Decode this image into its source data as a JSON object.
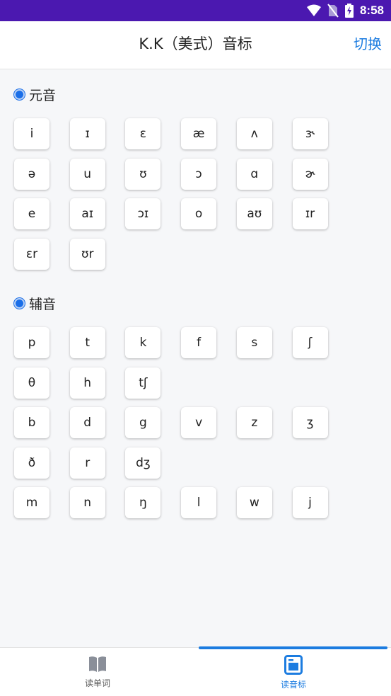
{
  "status_bar": {
    "time": "8:58"
  },
  "app_bar": {
    "title": "K.K（美式）音标",
    "action_label": "切换"
  },
  "vowels": {
    "label": "元音",
    "rows": [
      [
        "i",
        "ɪ",
        "ɛ",
        "æ",
        "ʌ",
        "ɝ"
      ],
      [
        "ə",
        "u",
        "ʊ",
        "ɔ",
        "ɑ",
        "ɚ"
      ],
      [
        "e",
        "aɪ",
        "ɔɪ",
        "o",
        "aʊ",
        "ɪr"
      ],
      [
        "ɛr",
        "ʊr"
      ]
    ]
  },
  "consonants": {
    "label": "辅音",
    "rows": [
      [
        "p",
        "t",
        "k",
        "f",
        "s",
        "ʃ"
      ],
      [
        "θ",
        "h",
        "tʃ"
      ],
      [
        "b",
        "d",
        "g",
        "v",
        "z",
        "ʒ"
      ],
      [
        "ð",
        "r",
        "dʒ"
      ],
      [
        "m",
        "n",
        "ŋ",
        "l",
        "w",
        "j"
      ]
    ]
  },
  "bottom_nav": {
    "items": [
      {
        "label": "读单词",
        "icon": "book-icon",
        "active": false
      },
      {
        "label": "读音标",
        "icon": "phonetic-icon",
        "active": true
      }
    ]
  },
  "colors": {
    "accent": "#1c7ce0",
    "status_bar": "#4b18b0",
    "inactive": "#555555"
  }
}
